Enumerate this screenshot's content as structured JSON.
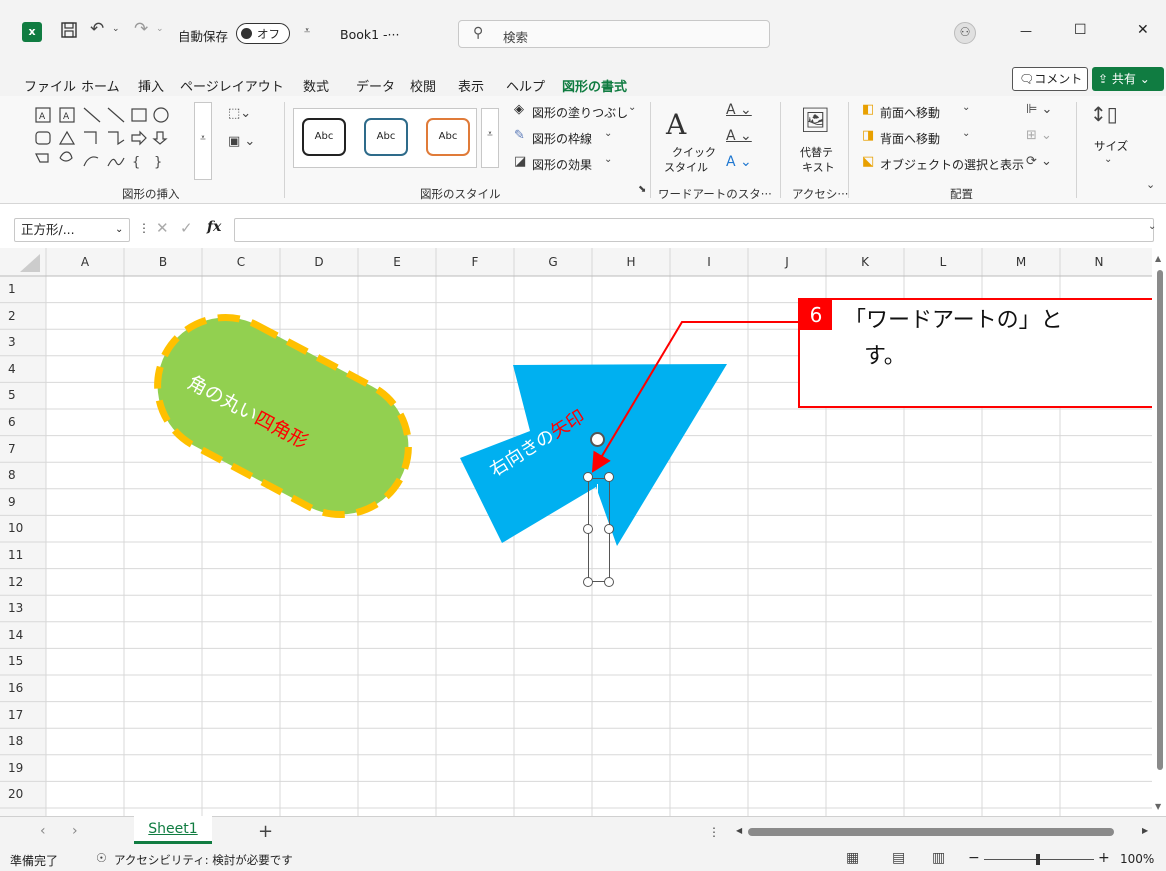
{
  "title_bar": {
    "autosave_label": "自動保存",
    "autosave_state": "オフ",
    "file_name": "Book1 -···",
    "search_placeholder": "検索",
    "minimize": "—",
    "maximize": "☐",
    "close": "✕"
  },
  "menu": {
    "tabs": [
      "ファイル",
      "ホーム",
      "挿入",
      "ページレイアウト",
      "数式",
      "データ",
      "校閲",
      "表示",
      "ヘルプ",
      "図形の書式"
    ],
    "active_tab": "図形の書式",
    "comment_button": "コメント",
    "share_button": "共有"
  },
  "ribbon": {
    "insert_shapes_label": "図形の挿入",
    "shape_styles_label": "図形のスタイル",
    "style_sample": "Abc",
    "fill_label": "図形の塗りつぶし",
    "outline_label": "図形の枠線",
    "effects_label": "図形の効果",
    "quick_style_label_1": "クイック",
    "quick_style_label_2": "スタイル",
    "wordart_label": "ワードアートのスタ···",
    "alt_text_label_1": "代替テ",
    "alt_text_label_2": "キスト",
    "accessibility_label": "アクセシ···",
    "bring_forward": "前面へ移動",
    "send_backward": "背面へ移動",
    "selection_pane": "オブジェクトの選択と表示",
    "arrange_label": "配置",
    "size_label": "サイズ"
  },
  "formula_bar": {
    "name_box": "正方形/...",
    "fx": "fx"
  },
  "columns": [
    "A",
    "B",
    "C",
    "D",
    "E",
    "F",
    "G",
    "H",
    "I",
    "J",
    "K",
    "L",
    "M",
    "N"
  ],
  "rows": [
    "1",
    "2",
    "3",
    "4",
    "5",
    "6",
    "7",
    "8",
    "9",
    "10",
    "11",
    "12",
    "13",
    "14",
    "15",
    "16",
    "17",
    "18",
    "19",
    "20"
  ],
  "shapes": {
    "rounded_rect_text_1": "角の丸い",
    "rounded_rect_text_2": "四角形",
    "arrow_text_1": "右向きの",
    "arrow_text_2": "矢印"
  },
  "callout": {
    "step": "6",
    "line1": "「ワードアートの」と",
    "line2": "す。"
  },
  "sheet_tabs": {
    "active": "Sheet1",
    "add": "+"
  },
  "status_bar": {
    "ready": "準備完了",
    "accessibility": "アクセシビリティ: 検討が必要です",
    "zoom": "100%"
  },
  "colors": {
    "accent_green": "#107c41",
    "shape_green": "#92d050",
    "shape_outline": "#ffc000",
    "arrow_blue": "#00b0f0",
    "callout_red": "#ff0000"
  }
}
